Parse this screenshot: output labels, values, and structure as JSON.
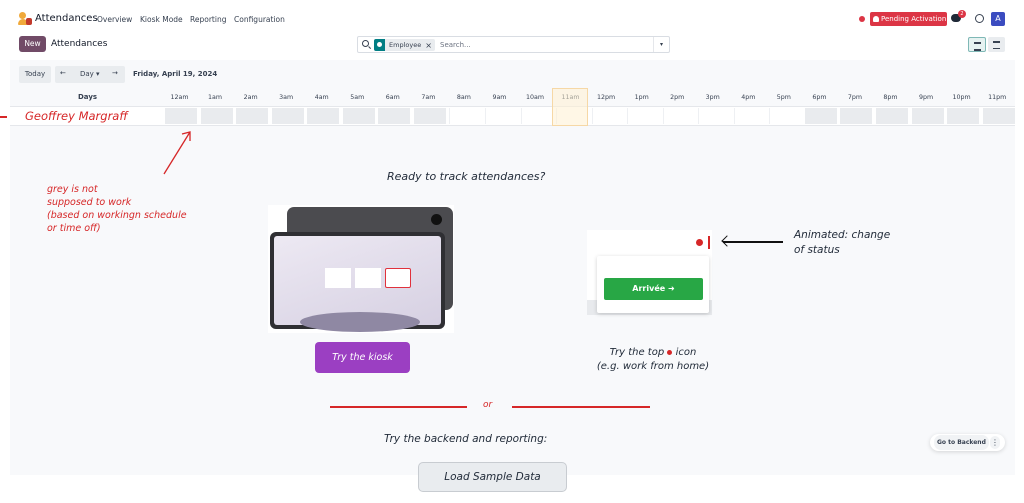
{
  "app": {
    "name": "Attendances",
    "menu": [
      "Overview",
      "Kiosk Mode",
      "Reporting",
      "Configuration"
    ]
  },
  "systray": {
    "pending_label": "Pending Activation",
    "chat_count": "2",
    "avatar_initial": "A",
    "status_color": "#dc3545"
  },
  "control_panel": {
    "new_label": "New",
    "breadcrumb": "Attendances",
    "facet_label": "Employee",
    "facet_remove": "×",
    "search_placeholder": "Search...",
    "search_toggle": "▾"
  },
  "gantt": {
    "today_label": "Today",
    "prev": "←",
    "scale_label": "Day ▾",
    "next": "→",
    "date": "Friday, April 19, 2024",
    "row_header": "Days",
    "hours": [
      "12am",
      "1am",
      "2am",
      "3am",
      "4am",
      "5am",
      "6am",
      "7am",
      "8am",
      "9am",
      "10am",
      "11am",
      "12pm",
      "1pm",
      "2pm",
      "3pm",
      "4pm",
      "5pm",
      "6pm",
      "7pm",
      "8pm",
      "9pm",
      "10pm",
      "11pm"
    ],
    "current_hour": "11am",
    "rows": [
      {
        "employee": "Geoffrey Margraff",
        "availability": [
          "off",
          "off",
          "off",
          "off",
          "off",
          "off",
          "off",
          "off",
          "on",
          "on",
          "on",
          "on",
          "on",
          "on",
          "on",
          "on",
          "on",
          "on",
          "off",
          "off",
          "off",
          "off",
          "off",
          "off"
        ]
      }
    ]
  },
  "help": {
    "grey_note": [
      "grey is not",
      "supposed to work",
      "(based on workingn schedule",
      "or time off)"
    ],
    "ready_title": "Ready to track attendances?",
    "kiosk_button": "Try the kiosk",
    "status_widget_button": "Arrivée ➜",
    "animated_note": [
      "Animated: change",
      "of status"
    ],
    "top_icon_note_a": "Try the top",
    "top_icon_note_b": "icon",
    "top_icon_note_c": "(e.g. work from home)",
    "or_label": "or",
    "backend_note": "Try the backend and reporting:",
    "sample_button": "Load Sample Data"
  },
  "floating": {
    "backend_label": "Go to Backend",
    "more_icon": "⋮"
  },
  "colors": {
    "brand": "#714b67",
    "annotation_red": "#d62728",
    "kiosk_purple": "#9b3fc2",
    "arrive_green": "#28a745",
    "off_hours_grey": "#e9ebee"
  }
}
